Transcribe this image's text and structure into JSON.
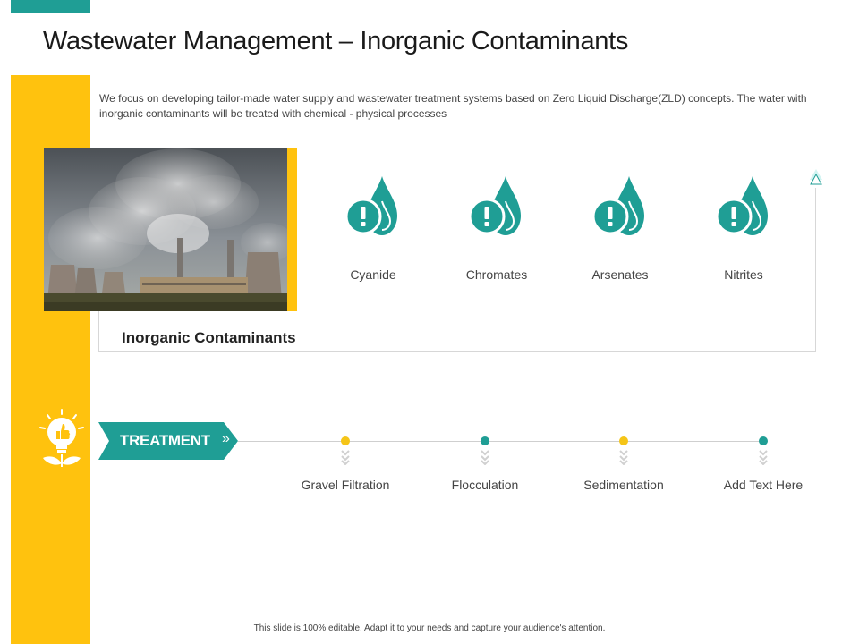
{
  "slide": {
    "title": "Wastewater Management – Inorganic Contaminants",
    "intro": "We focus on developing tailor-made water supply and wastewater treatment systems based on Zero Liquid Discharge(ZLD) concepts. The water with inorganic contaminants will be treated with chemical - physical processes",
    "footer": "This slide is 100% editable.  Adapt it to your needs and capture your audience's attention."
  },
  "contaminants": {
    "heading": "Inorganic Contaminants",
    "icon": "water-drop-warning-icon",
    "items": [
      {
        "label": "Cyanide"
      },
      {
        "label": "Chromates"
      },
      {
        "label": "Arsenates"
      },
      {
        "label": "Nitrites"
      }
    ]
  },
  "treatment": {
    "label": "TREATMENT",
    "icon": "lightbulb-thumbs-up-icon",
    "steps": [
      {
        "label": "Gravel Filtration",
        "color": "#f5c518"
      },
      {
        "label": "Flocculation",
        "color": "#1f9e95"
      },
      {
        "label": "Sedimentation",
        "color": "#f5c518"
      },
      {
        "label": "Add Text Here",
        "color": "#1f9e95"
      }
    ]
  },
  "colors": {
    "teal": "#1f9e95",
    "yellow": "#ffc20e"
  }
}
